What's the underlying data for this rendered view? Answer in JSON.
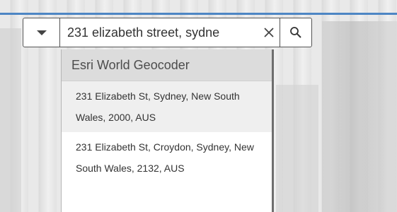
{
  "search": {
    "value": "231 elizabeth street, sydne",
    "clear_icon": "close-icon",
    "search_icon": "search-icon",
    "source_icon": "caret-down-icon"
  },
  "suggestions": {
    "source_name": "Esri World Geocoder",
    "items": [
      {
        "text": "231 Elizabeth St, Sydney, New South Wales, 2000, AUS"
      },
      {
        "text": "231 Elizabeth St, Croydon, Sydney, New South Wales, 2132, AUS"
      }
    ]
  },
  "colors": {
    "header_bg": "#dcdcdc",
    "highlight_bg": "#efefef",
    "border": "#545454"
  }
}
